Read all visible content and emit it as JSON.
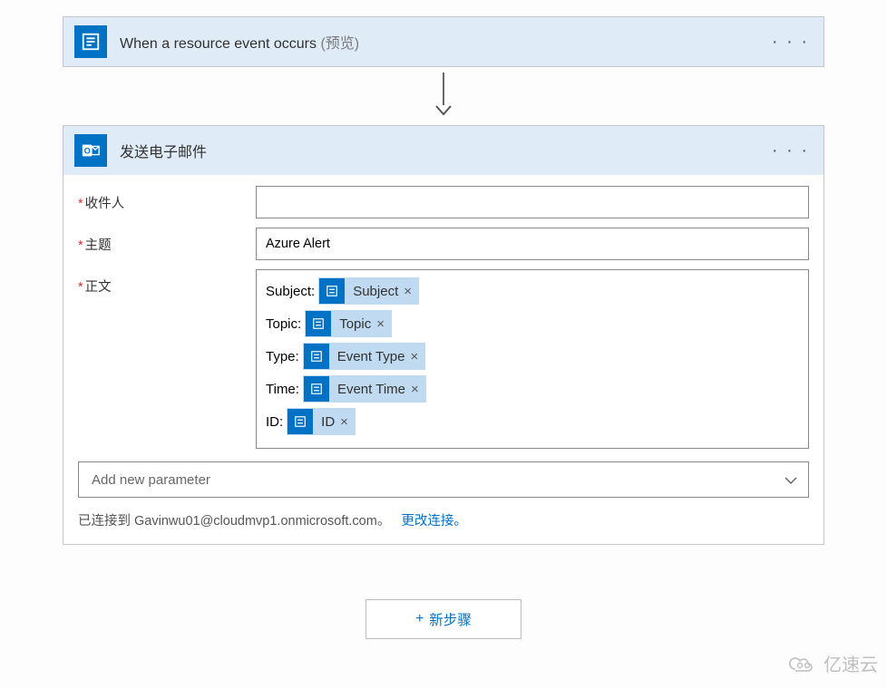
{
  "trigger": {
    "title": "When a resource event occurs",
    "preview": "(预览)",
    "more": "· · ·"
  },
  "action": {
    "title": "发送电子邮件",
    "more": "· · ·",
    "fields": {
      "recipient_label": "收件人",
      "recipient_value": "",
      "subject_label": "主题",
      "subject_value": "Azure Alert",
      "body_label": "正文"
    },
    "body_lines": [
      {
        "label": "Subject:",
        "token": "Subject"
      },
      {
        "label": "Topic:",
        "token": "Topic"
      },
      {
        "label": "Type:",
        "token": "Event Type"
      },
      {
        "label": "Time:",
        "token": "Event Time"
      },
      {
        "label": "ID:",
        "token": "ID"
      }
    ],
    "token_x": "×",
    "add_parameter": "Add new parameter",
    "connection_prefix": "已连接到 ",
    "connection_account": "Gavinwu01@cloudmvp1.onmicrosoft.com",
    "connection_suffix": "。",
    "change_connection": "更改连接。"
  },
  "new_step": {
    "plus": "+",
    "label": "新步骤"
  },
  "watermark": "亿速云"
}
